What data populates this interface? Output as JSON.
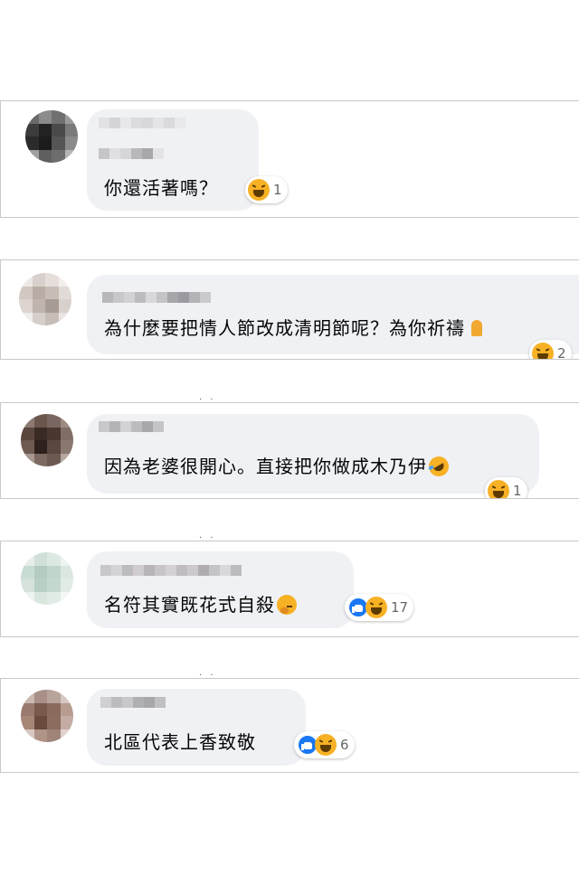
{
  "comments": [
    {
      "text": "你還活著嗎？",
      "inline_emoji": "",
      "reactions": [
        "haha"
      ],
      "count": "1"
    },
    {
      "text": "為什麼要把情人節改成清明節呢？為你祈禱",
      "inline_emoji": "folded-hands",
      "reactions": [
        "haha"
      ],
      "count": "2"
    },
    {
      "text": "因為老婆很開心。直接把你做成木乃伊",
      "inline_emoji": "rolling-laughing",
      "reactions": [
        "haha"
      ],
      "count": "1"
    },
    {
      "text": "名符其實既花式自殺",
      "inline_emoji": "thinking-face",
      "reactions": [
        "like",
        "haha"
      ],
      "count": "17"
    },
    {
      "text": "北區代表上香致敬",
      "inline_emoji": "",
      "reactions": [
        "like",
        "haha"
      ],
      "count": "6"
    }
  ],
  "colors": {
    "bubble": "#eff1f4",
    "like": "#1877f2",
    "haha": "#f7b125",
    "count": "#65676b"
  }
}
